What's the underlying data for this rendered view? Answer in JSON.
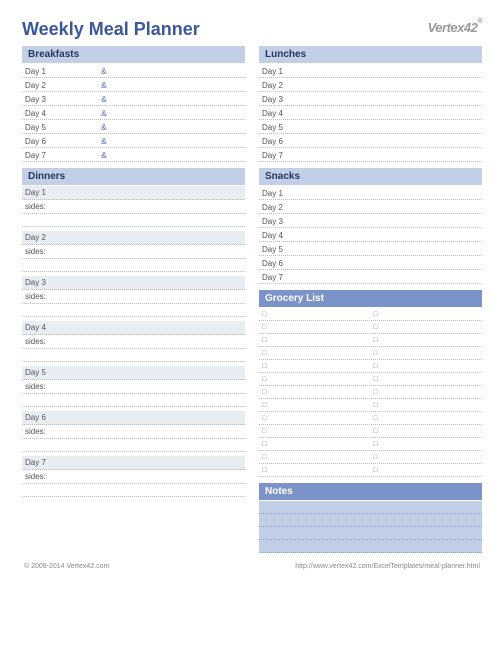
{
  "title": "Weekly Meal Planner",
  "logo": "Vertex42",
  "sections": {
    "breakfasts": {
      "header": "Breakfasts",
      "days": [
        "Day 1",
        "Day 2",
        "Day 3",
        "Day 4",
        "Day 5",
        "Day 6",
        "Day 7"
      ],
      "amp": "&"
    },
    "lunches": {
      "header": "Lunches",
      "days": [
        "Day 1",
        "Day 2",
        "Day 3",
        "Day 4",
        "Day 5",
        "Day 6",
        "Day 7"
      ]
    },
    "dinners": {
      "header": "Dinners",
      "days": [
        "Day 1",
        "Day 2",
        "Day 3",
        "Day 4",
        "Day 5",
        "Day 6",
        "Day 7"
      ],
      "sides_label": "sides:"
    },
    "snacks": {
      "header": "Snacks",
      "days": [
        "Day 1",
        "Day 2",
        "Day 3",
        "Day 4",
        "Day 5",
        "Day 6",
        "Day 7"
      ]
    },
    "grocery": {
      "header": "Grocery List",
      "rows": 13
    },
    "notes": {
      "header": "Notes",
      "lines": 4
    }
  },
  "footer": {
    "copyright": "© 2009-2014 Vertex42.com",
    "url": "http://www.vertex42.com/ExcelTemplates/meal-planner.html"
  }
}
